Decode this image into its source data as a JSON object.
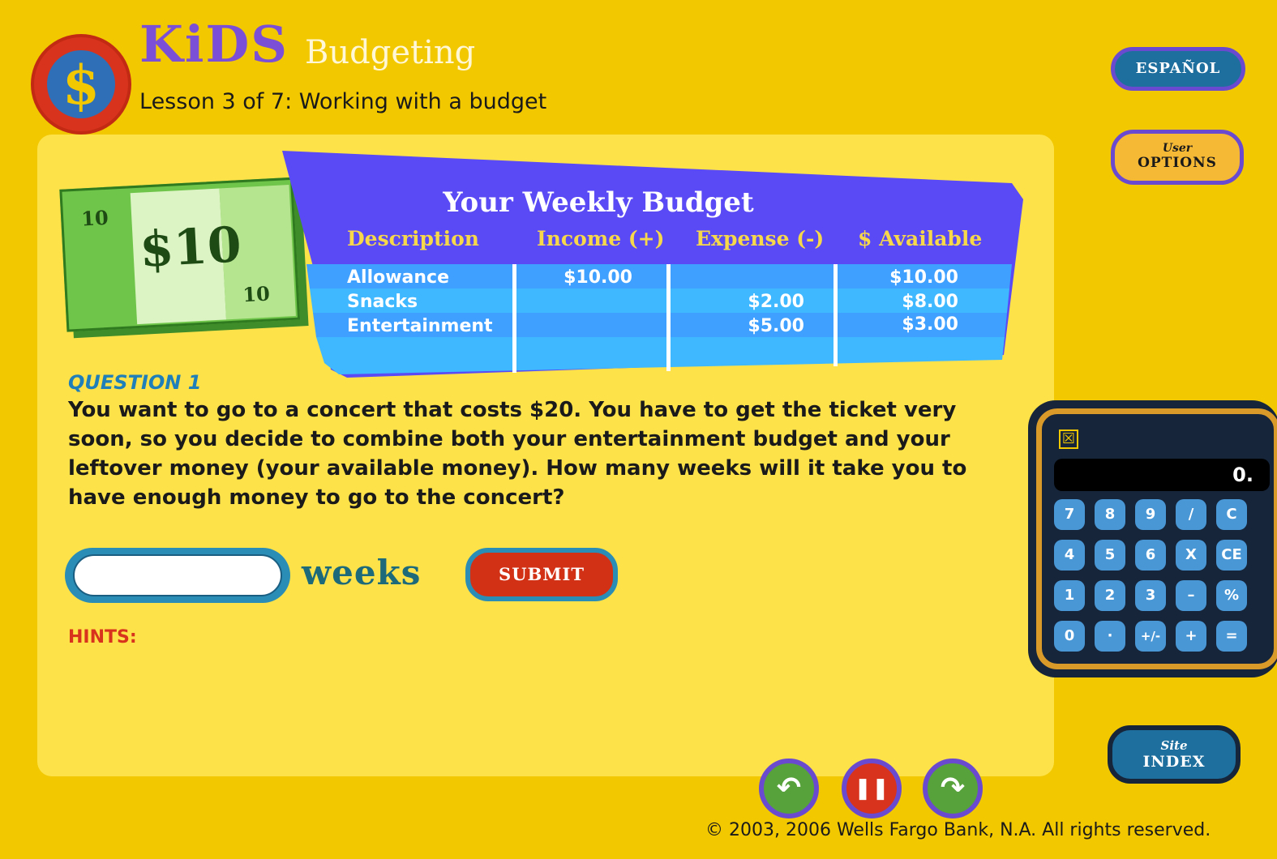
{
  "header": {
    "brand": "KiDS",
    "topic": "Budgeting",
    "lesson": "Lesson 3 of 7: Working with a budget",
    "logo_glyph": "$"
  },
  "buttons": {
    "espanol": "ESPAÑOL",
    "user_options_small": "User",
    "user_options_big": "OPTIONS",
    "site_index_small": "Site",
    "site_index_big": "INDEX",
    "submit": "SUBMIT"
  },
  "bill": {
    "symbol": "$10",
    "corner_top": "10",
    "corner_bottom": "10"
  },
  "budget": {
    "title": "Your Weekly Budget",
    "headers": [
      "Description",
      "Income (+)",
      "Expense (-)",
      "$ Available"
    ],
    "rows": [
      {
        "description": "Allowance",
        "income": "$10.00",
        "expense": "",
        "available": "$10.00"
      },
      {
        "description": "Snacks",
        "income": "",
        "expense": "$2.00",
        "available": "$8.00"
      },
      {
        "description": "Entertainment",
        "income": "",
        "expense": "$5.00",
        "available": "$3.00"
      }
    ]
  },
  "question": {
    "label": "QUESTION 1",
    "text": "You want to go to a concert that costs $20. You have to get the ticket very soon, so you decide to combine both your entertainment budget and your leftover money (your available money). How many weeks will it take you to have enough money to go to the concert?",
    "answer_value": "",
    "unit": "weeks",
    "hints_label": "HINTS:"
  },
  "calculator": {
    "display": "0.",
    "close_icon": "☒",
    "keys": [
      "7",
      "8",
      "9",
      "/",
      "C",
      "4",
      "5",
      "6",
      "X",
      "CE",
      "1",
      "2",
      "3",
      "–",
      "%",
      "0",
      "·",
      "+/-",
      "+",
      "="
    ]
  },
  "nav": {
    "back_icon": "↶",
    "pause_icon": "❚❚",
    "forward_icon": "↷"
  },
  "footer": {
    "copyright": "© 2003, 2006 Wells Fargo Bank, N.A. All rights reserved."
  }
}
